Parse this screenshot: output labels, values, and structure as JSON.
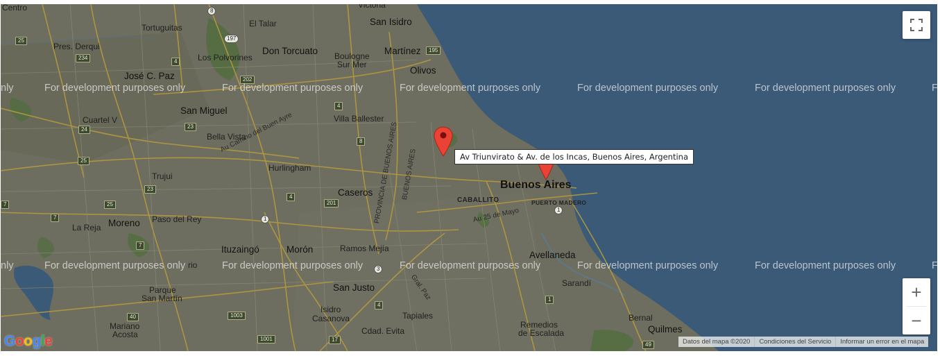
{
  "map": {
    "places": [
      {
        "id": "centro",
        "text": "Centro"
      },
      {
        "id": "tortuguitas",
        "text": "Tortuguitas"
      },
      {
        "id": "el-talar",
        "text": "El Talar"
      },
      {
        "id": "san-isidro",
        "text": "San Isidro"
      },
      {
        "id": "victoria",
        "text": "Victoria"
      },
      {
        "id": "pres-derqui",
        "text": "Pres. Derqui"
      },
      {
        "id": "los-polvorines",
        "text": "Los Polvorines"
      },
      {
        "id": "don-torcuato",
        "text": "Don Torcuato"
      },
      {
        "id": "boulogne",
        "text": "Boulogne"
      },
      {
        "id": "sur-mer",
        "text": "Sur Mer"
      },
      {
        "id": "martinez",
        "text": "Martínez"
      },
      {
        "id": "jose-c-paz",
        "text": "José C. Paz"
      },
      {
        "id": "olivos",
        "text": "Olivos"
      },
      {
        "id": "san-miguel",
        "text": "San Miguel"
      },
      {
        "id": "villa-ballester",
        "text": "Villa Ballester"
      },
      {
        "id": "cuartel-v",
        "text": "Cuartel V"
      },
      {
        "id": "bella-vista",
        "text": "Bella Vista"
      },
      {
        "id": "camino-buen-ayre",
        "text": "Au Camino del Buen Ayre"
      },
      {
        "id": "hurlingham",
        "text": "Hurlingham"
      },
      {
        "id": "trujui",
        "text": "Trujui"
      },
      {
        "id": "caseros",
        "text": "Caseros"
      },
      {
        "id": "buenos-aires",
        "text": "Buenos Aires"
      },
      {
        "id": "caballito",
        "text": "CABALLITO"
      },
      {
        "id": "puerto-madero",
        "text": "PUERTO MADERO"
      },
      {
        "id": "au-25-mayo",
        "text": "Au 25 de Mayo"
      },
      {
        "id": "moreno",
        "text": "Moreno"
      },
      {
        "id": "paso-del-rey",
        "text": "Paso del Rey"
      },
      {
        "id": "la-reja",
        "text": "La Reja"
      },
      {
        "id": "ituzaingo",
        "text": "Ituzaingó"
      },
      {
        "id": "moron",
        "text": "Morón"
      },
      {
        "id": "ramos-mejia",
        "text": "Ramos Mejía"
      },
      {
        "id": "avellaneda",
        "text": "Avellaneda"
      },
      {
        "id": "rio",
        "text": "rio"
      },
      {
        "id": "sarandi",
        "text": "Sarandí"
      },
      {
        "id": "parque",
        "text": "Parque"
      },
      {
        "id": "san-martin",
        "text": "San Martín"
      },
      {
        "id": "san-justo",
        "text": "San Justo"
      },
      {
        "id": "isidro",
        "text": "Isidro"
      },
      {
        "id": "casanova",
        "text": "Casanova"
      },
      {
        "id": "tapiales",
        "text": "Tapiales"
      },
      {
        "id": "remedios",
        "text": "Remedios"
      },
      {
        "id": "de-escalada",
        "text": "de Escalada"
      },
      {
        "id": "bernal",
        "text": "Bernal"
      },
      {
        "id": "quilmes",
        "text": "Quilmes"
      },
      {
        "id": "mariano",
        "text": "Mariano"
      },
      {
        "id": "acosta",
        "text": "Acosta"
      },
      {
        "id": "cdad-evita",
        "text": "Cdad. Evita"
      },
      {
        "id": "gral-paz",
        "text": "Gral. Paz"
      },
      {
        "id": "prov-buenos-aires",
        "text": "PROVINCIA DE BUENOS AIRES"
      },
      {
        "id": "buenos-aires-road",
        "text": "BUENOS AIRES"
      }
    ],
    "shields": [
      "8",
      "197",
      "202",
      "234",
      "25",
      "4",
      "8",
      "24",
      "23",
      "25",
      "23",
      "25",
      "201",
      "4",
      "7",
      "7",
      "7",
      "1",
      "3",
      "4",
      "40",
      "1003",
      "1001",
      "17",
      "1",
      "49",
      "195",
      "4"
    ],
    "watermark": "For development purposes only",
    "watermark_edge_left": "nly",
    "watermark_edge_right": "F",
    "tooltip": "Av Triunvirato & Av. de los Incas, Buenos Aires, Argentina",
    "marker_color": "#ea4335",
    "water_color": "#3a5a78",
    "land_color": "#6d6d5f"
  },
  "controls": {
    "zoom_in": "+",
    "zoom_out": "−"
  },
  "attribution": {
    "data": "Datos del mapa ©2020",
    "terms": "Condiciones del Servicio",
    "report": "Informar un error en el mapa"
  },
  "logo": {
    "letters": [
      "G",
      "o",
      "o",
      "g",
      "l",
      "e"
    ]
  }
}
